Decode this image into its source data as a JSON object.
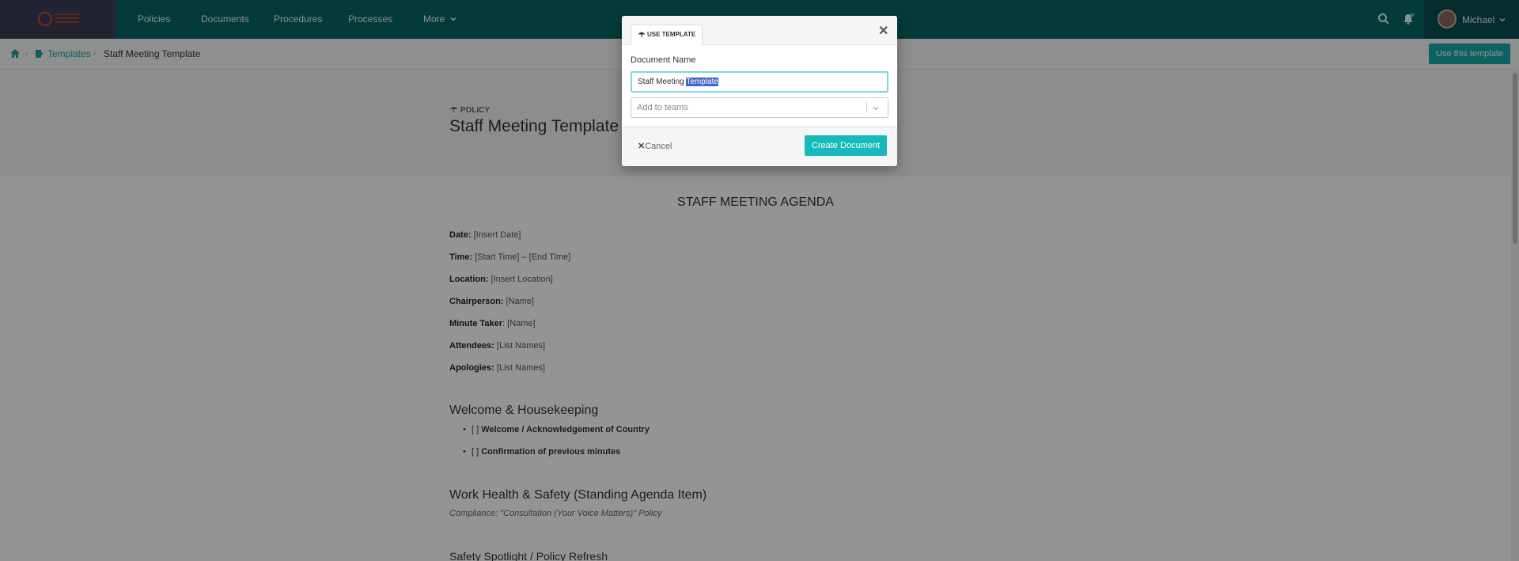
{
  "nav": {
    "items": [
      "Policies",
      "Documents",
      "Procedures",
      "Processes",
      "More"
    ],
    "user_name": "Michael",
    "icons": [
      "search-icon",
      "bell-icon",
      "chevron-down-icon"
    ]
  },
  "breadcrumb": {
    "link": "Templates",
    "current": "Staff Meeting Template"
  },
  "toolbar": {
    "use_label": "Use this template"
  },
  "header": {
    "tag": "POLICY",
    "title": "Staff Meeting Template"
  },
  "content": {
    "agenda_title": "STAFF MEETING AGENDA",
    "fields": [
      {
        "label": "Date:",
        "value": " [Insert Date]"
      },
      {
        "label": "Time:",
        "value": " [Start Time] – [End Time]"
      },
      {
        "label": "Location:",
        "value": " [Insert Location]"
      },
      {
        "label": "Chairperson:",
        "value": " [Name]"
      },
      {
        "label": "Minute Taker",
        "value": ": [Name]"
      },
      {
        "label": "Attendees:",
        "value": " [List Names]"
      },
      {
        "label": "Apologies:",
        "value": " [List Names]"
      }
    ],
    "sections": [
      {
        "heading": "Welcome & Housekeeping",
        "items": [
          {
            "prefix": "[ ] ",
            "text": "Welcome / Acknowledgement of Country"
          },
          {
            "prefix": "[ ] ",
            "text": "Confirmation of previous minutes"
          }
        ]
      },
      {
        "heading": "Work Health & Safety (Standing Agenda Item)",
        "note": "Compliance: \"Consultation (Your Voice Matters)\" Policy"
      },
      {
        "heading": "Safety Spotlight / Policy Refresh"
      }
    ]
  },
  "modal": {
    "tab_label": "USE TEMPLATE",
    "field_label": "Document Name",
    "input_value_plain": "Staff Meeting ",
    "input_value_selected": "Template",
    "teams_placeholder": "Add to teams",
    "cancel_label": "Cancel",
    "create_label": "Create Document"
  },
  "colors": {
    "nav_bg": "#0a6566",
    "accent": "#18b9bb",
    "link": "#1aa1a2"
  }
}
